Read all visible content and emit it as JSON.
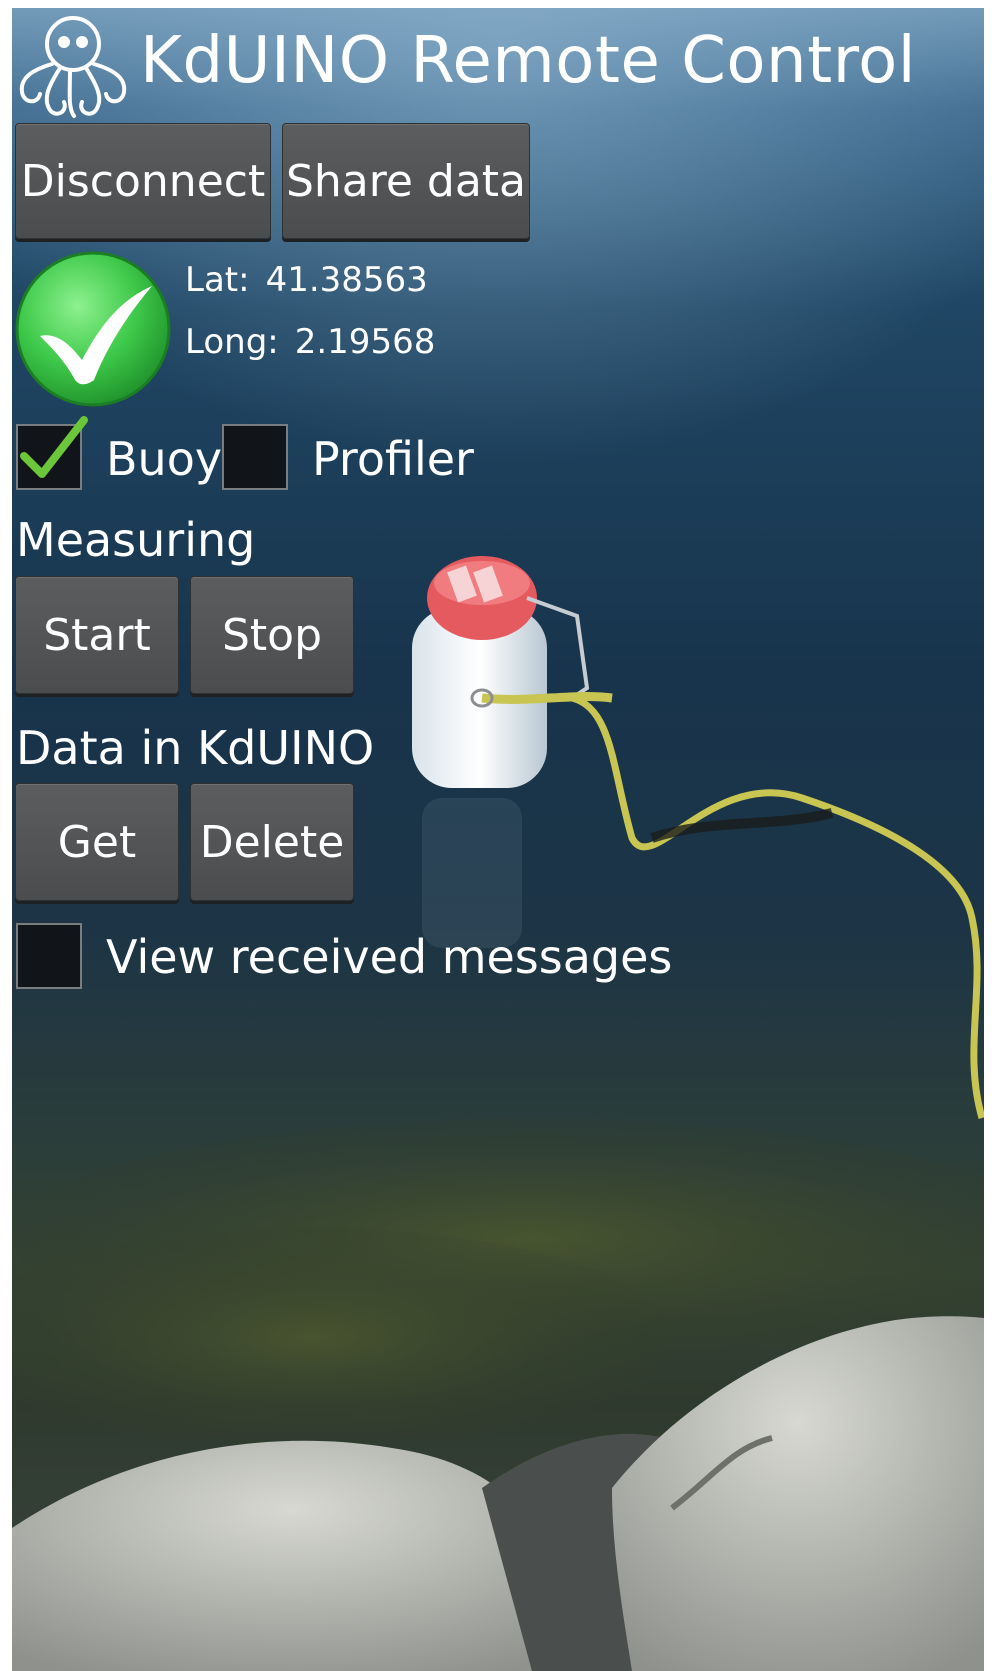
{
  "app": {
    "title": "KdUINO Remote Control",
    "logo_icon": "octopus-logo-icon"
  },
  "toolbar": {
    "disconnect_label": "Disconnect",
    "share_label": "Share data"
  },
  "status": {
    "icon": "check-circle-icon",
    "color": "#3ec94a",
    "lat_label": "Lat:",
    "lat_value": "41.38563",
    "long_label": "Long:",
    "long_value": "2.19568"
  },
  "mode": {
    "buoy_label": "Buoy",
    "buoy_checked": true,
    "profiler_label": "Profiler",
    "profiler_checked": false
  },
  "measuring": {
    "heading": "Measuring",
    "start_label": "Start",
    "stop_label": "Stop"
  },
  "data_section": {
    "heading": "Data in KdUINO",
    "get_label": "Get",
    "delete_label": "Delete"
  },
  "messages": {
    "view_label": "View received messages",
    "checked": false
  },
  "colors": {
    "check_green": "#6cc63a",
    "button_gray": "#525456"
  }
}
